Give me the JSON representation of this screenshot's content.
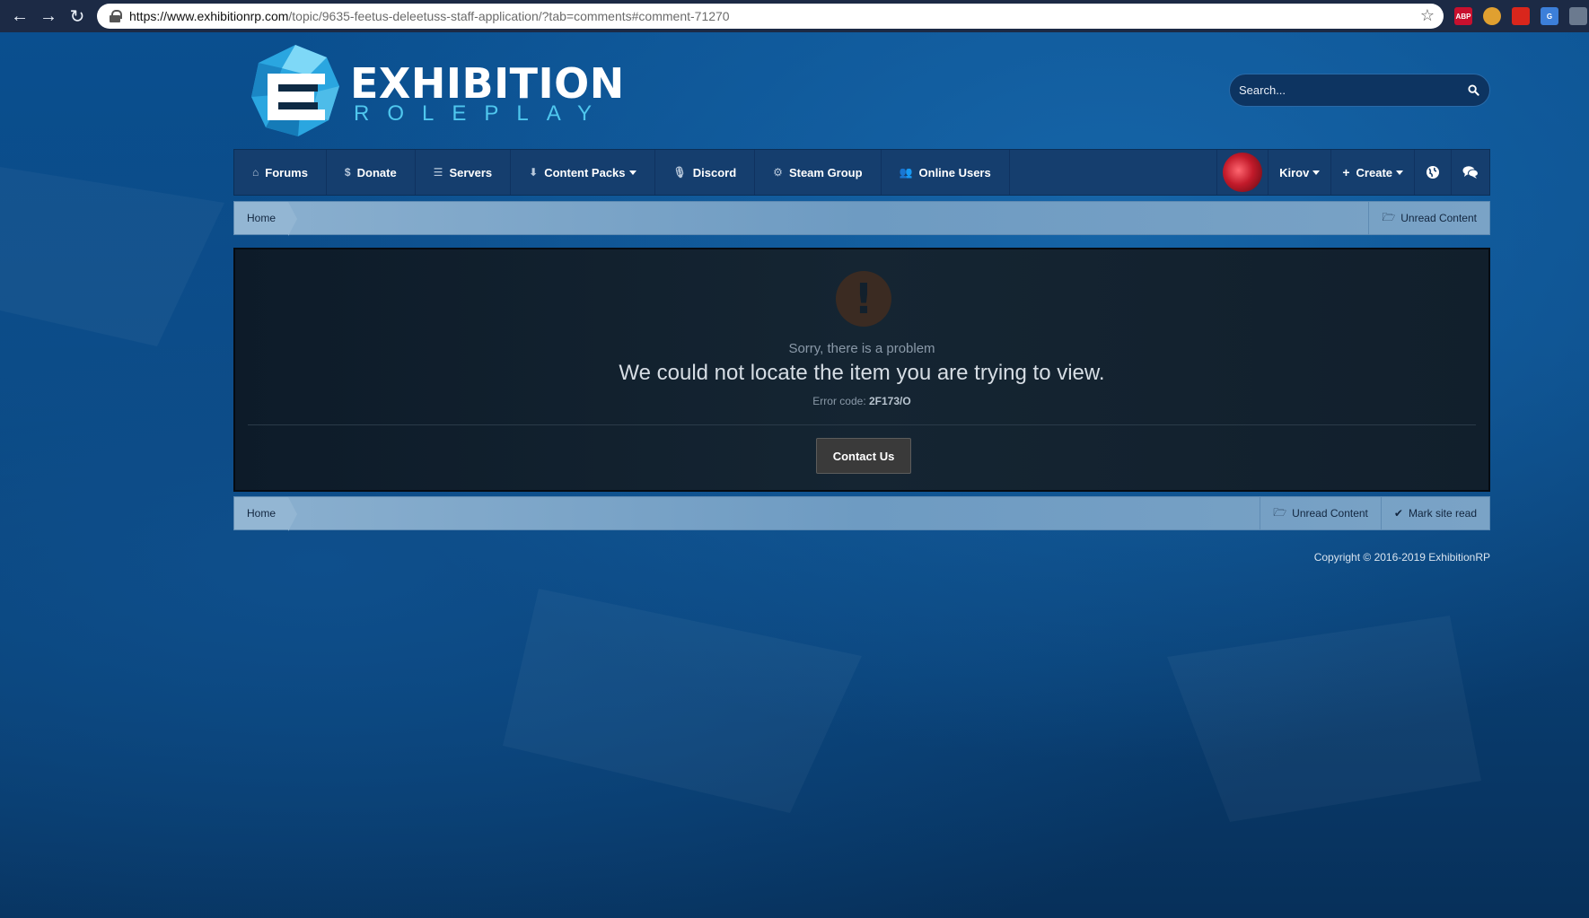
{
  "browser": {
    "url_host": "https://www.exhibitionrp.com",
    "url_path": "/topic/9635-feetus-deleetuss-staff-application/?tab=comments#comment-71270",
    "extensions": [
      {
        "name": "adblock-plus-icon",
        "label": "ABP",
        "color": "#c8102e"
      },
      {
        "name": "cookie-icon",
        "label": "",
        "color": "#e0a030"
      },
      {
        "name": "red-extension-icon",
        "label": "",
        "color": "#d9261c"
      },
      {
        "name": "translate-icon",
        "label": "",
        "color": "#3c7fd9"
      },
      {
        "name": "profile-icon",
        "label": "",
        "color": "#6b7a8f"
      }
    ]
  },
  "logo": {
    "title": "EXHIBITION",
    "subtitle": "ROLEPLAY"
  },
  "search": {
    "placeholder": "Search..."
  },
  "nav": {
    "items": [
      {
        "label": "Forums",
        "icon": "⌂"
      },
      {
        "label": "Donate",
        "icon": "$"
      },
      {
        "label": "Servers",
        "icon": "☰"
      },
      {
        "label": "Content Packs",
        "icon": "⬇",
        "dropdown": true
      },
      {
        "label": "Discord",
        "icon": "🎙"
      },
      {
        "label": "Steam Group",
        "icon": "⚙"
      },
      {
        "label": "Online Users",
        "icon": "👥"
      }
    ],
    "user": "Kirov",
    "create": "Create"
  },
  "breadcrumb": {
    "home": "Home",
    "unread": "Unread Content",
    "mark_read": "Mark site read"
  },
  "error": {
    "subtitle": "Sorry, there is a problem",
    "message": "We could not locate the item you are trying to view.",
    "code_label": "Error code:",
    "code": "2F173/O",
    "contact": "Contact Us"
  },
  "footer": {
    "copyright": "Copyright © 2016-2019 ExhibitionRP"
  }
}
